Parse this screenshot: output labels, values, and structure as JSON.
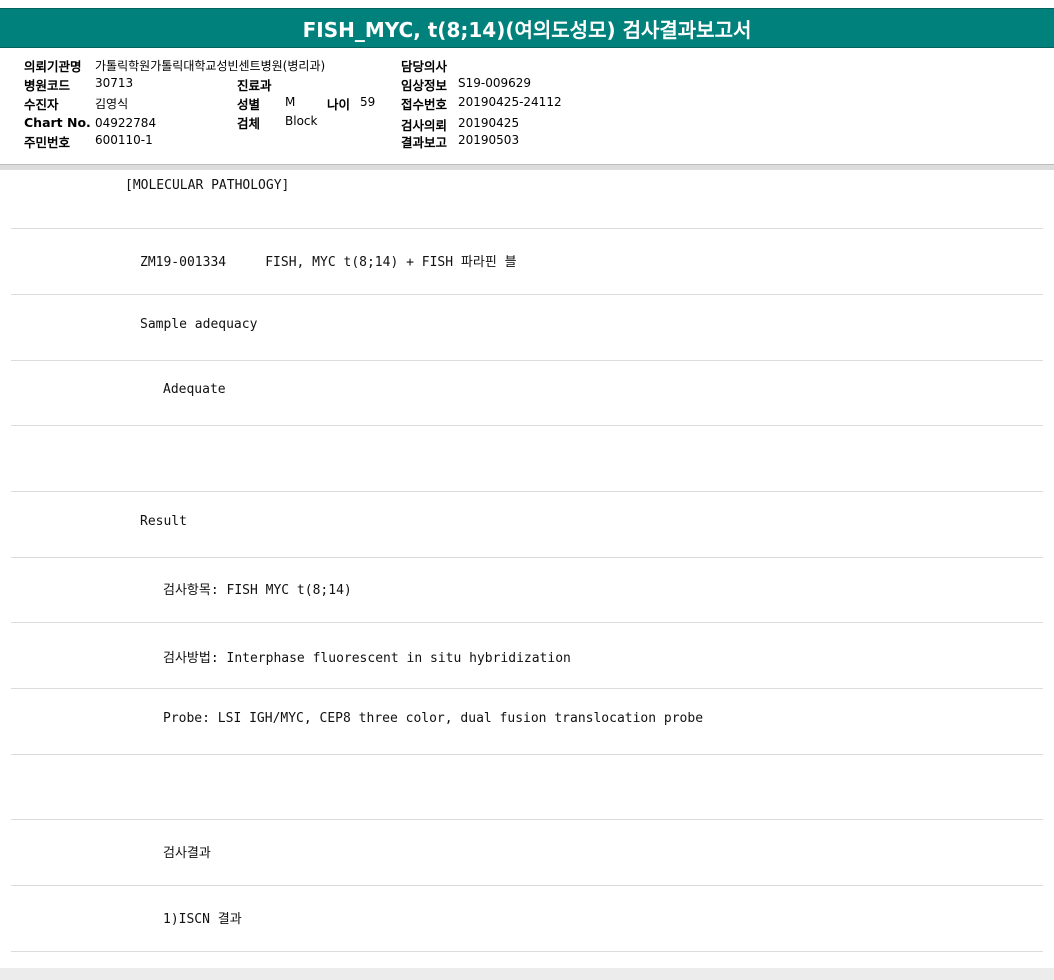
{
  "title": "FISH_MYC, t(8;14)(여의도성모) 검사결과보고서",
  "patient_info": {
    "institution_label": "의뢰기관명",
    "institution_value": "가톨릭학원가톨릭대학교성빈센트병원(병리과)",
    "doctor_label": "담당의사",
    "doctor_value": "",
    "hospital_code_label": "병원코드",
    "hospital_code_value": "30713",
    "department_label": "진료과",
    "department_value": "",
    "clinical_info_label": "임상정보",
    "clinical_info_value": "S19-009629",
    "patient_label": "수진자",
    "patient_value": "김영식",
    "sex_label": "성별",
    "sex_value": "M",
    "age_label": "나이",
    "age_value": "59",
    "receipt_no_label": "접수번호",
    "receipt_no_value": "20190425-24112",
    "chart_no_label": "Chart No.",
    "chart_no_value": "04922784",
    "specimen_label": "검체",
    "specimen_value": "Block",
    "request_label": "검사의뢰",
    "request_value": "20190425",
    "resident_no_label": "주민번호",
    "resident_no_value": "600110-1",
    "report_label": "결과보고",
    "report_value": "20190503"
  },
  "report_lines": [
    "[MOLECULAR PATHOLOGY]",
    "ZM19-001334     FISH, MYC t(8;14) + FISH 파라핀 블",
    "Sample adequacy",
    "Adequate",
    "",
    "Result",
    "검사항목: FISH MYC t(8;14)",
    "검사방법: Interphase fluorescent in situ hybridization",
    "Probe: LSI IGH/MYC, CEP8 three color, dual fusion translocation probe",
    "",
    "검사결과",
    "1)ISCN 결과"
  ],
  "colors": {
    "title_bar": "#00817c",
    "divider": "#dcdcdc"
  }
}
